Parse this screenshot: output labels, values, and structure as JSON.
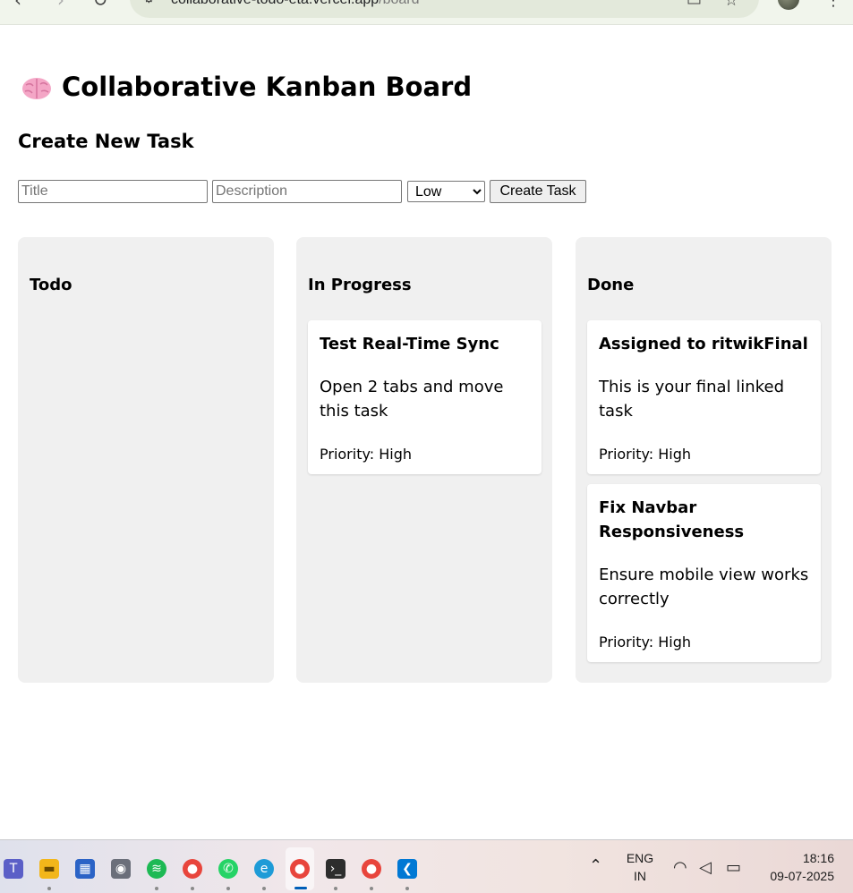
{
  "browser": {
    "url_host": "collaborative-todo-eta.vercel.app",
    "url_path": "/board"
  },
  "page": {
    "title": "Collaborative Kanban Board",
    "title_icon": "brain-emoji",
    "create_section_title": "Create New Task"
  },
  "form": {
    "title_placeholder": "Title",
    "description_placeholder": "Description",
    "priority_selected": "Low",
    "create_button_label": "Create Task"
  },
  "columns": [
    {
      "title": "Todo",
      "cards": []
    },
    {
      "title": "In Progress",
      "cards": [
        {
          "title": "Test Real-Time Sync",
          "description": "Open 2 tabs and move this task",
          "priority": "Priority: High"
        }
      ]
    },
    {
      "title": "Done",
      "cards": [
        {
          "title": "Assigned to ritwikFinal",
          "description": "This is your final linked task",
          "priority": "Priority: High"
        },
        {
          "title": "Fix Navbar Responsiveness",
          "description": "Ensure mobile view works correctly",
          "priority": "Priority: High"
        }
      ]
    }
  ],
  "taskbar": {
    "apps": [
      "teams-icon",
      "file-explorer-icon",
      "store-icon",
      "camera-icon",
      "spotify-icon",
      "chrome-profile-icon",
      "whatsapp-icon",
      "edge-icon",
      "chrome-icon",
      "terminal-icon",
      "chrome-profile-2-icon",
      "vscode-icon"
    ],
    "language": "ENG",
    "region": "IN",
    "time": "18:16",
    "date": "09-07-2025"
  },
  "colors": {
    "column_bg": "#f0f0f0",
    "card_bg": "#ffffff",
    "page_bg": "#ffffff"
  }
}
